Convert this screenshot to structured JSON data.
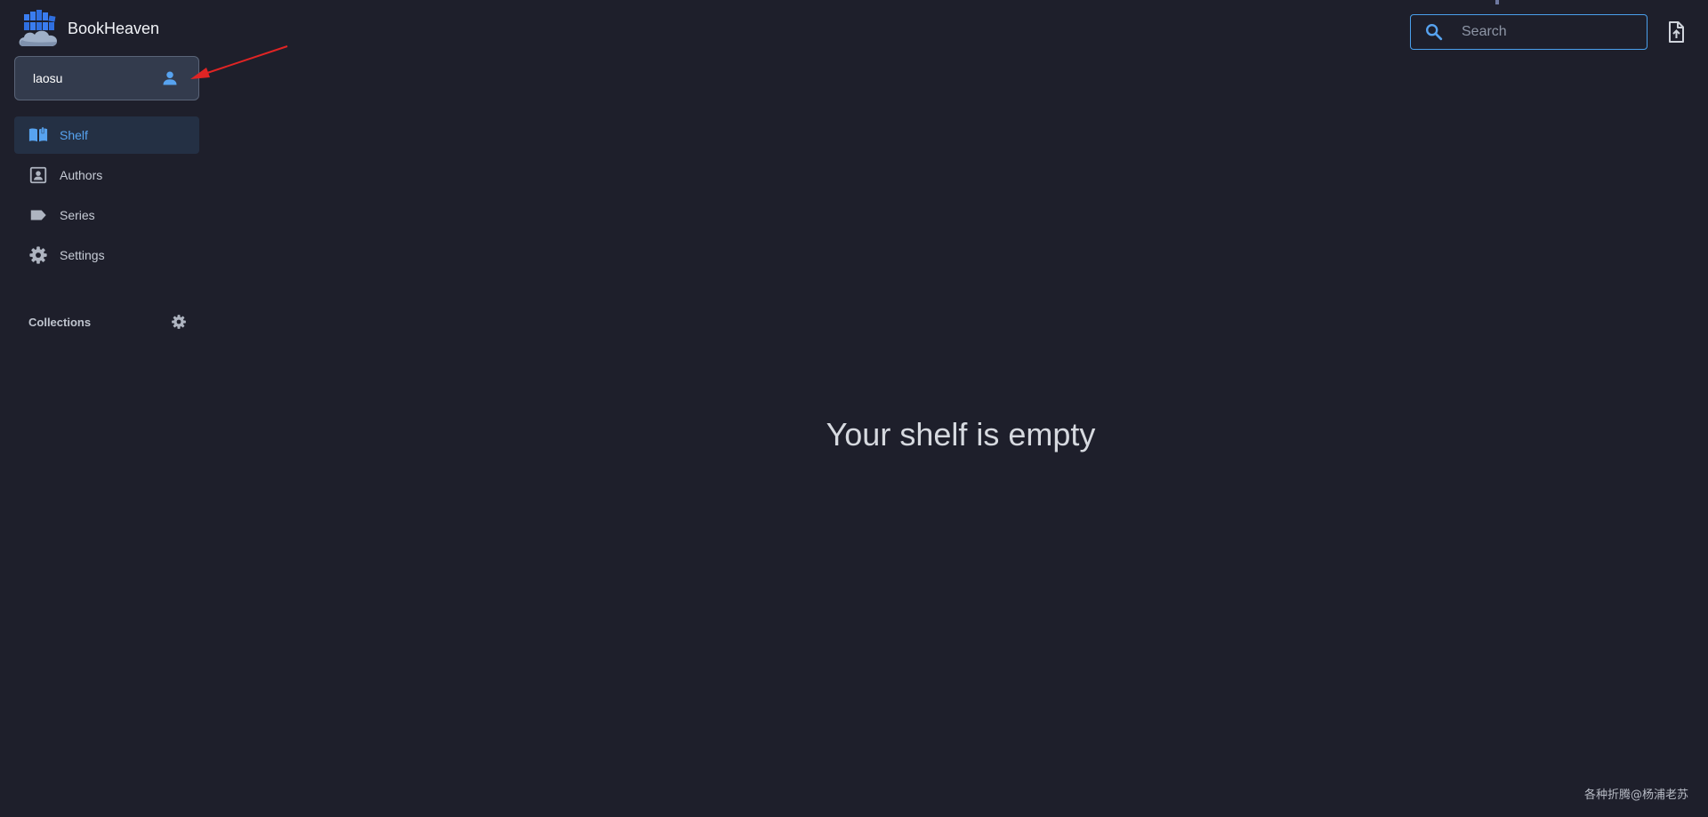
{
  "brand": {
    "name": "BookHeaven",
    "logo_icon": "cloud-bookshelf-logo-icon"
  },
  "user": {
    "name": "laosu",
    "icon": "person-icon"
  },
  "nav": {
    "items": [
      {
        "label": "Shelf",
        "icon": "open-book-icon",
        "active": true
      },
      {
        "label": "Authors",
        "icon": "contact-card-icon",
        "active": false
      },
      {
        "label": "Series",
        "icon": "label-tag-icon",
        "active": false
      },
      {
        "label": "Settings",
        "icon": "gear-icon",
        "active": false
      }
    ]
  },
  "collections": {
    "title": "Collections",
    "settings_icon": "gear-icon"
  },
  "header": {
    "search": {
      "placeholder": "Search",
      "value": "",
      "icon": "search-icon"
    },
    "upload_icon": "file-upload-icon"
  },
  "main": {
    "empty_message": "Your shelf is empty"
  },
  "watermark": {
    "text": "各种折腾@杨浦老苏"
  },
  "colors": {
    "background": "#1e1f2b",
    "accent": "#57a3f0",
    "active_nav_bg": "#243044",
    "user_card_bg": "#333b4d",
    "annotation_arrow": "#e02424"
  }
}
